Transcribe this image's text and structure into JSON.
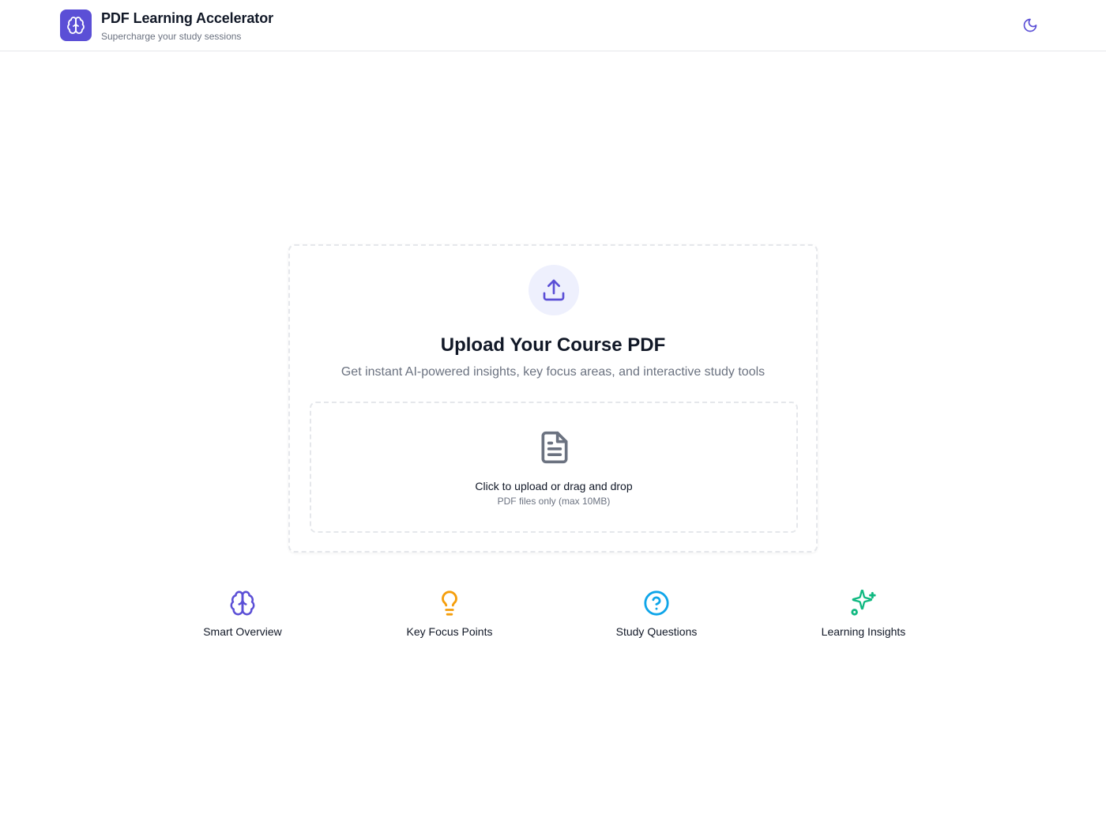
{
  "header": {
    "title": "PDF Learning Accelerator",
    "subtitle": "Supercharge your study sessions",
    "logo_icon": "brain-icon",
    "theme_toggle_icon": "moon-icon"
  },
  "upload": {
    "icon": "upload-icon",
    "title": "Upload Your Course PDF",
    "description": "Get instant AI-powered insights, key focus areas, and interactive study tools",
    "dropzone": {
      "icon": "file-text-icon",
      "primary": "Click to upload or drag and drop",
      "secondary": "PDF files only (max 10MB)"
    }
  },
  "features": [
    {
      "label": "Smart Overview",
      "icon": "brain-icon",
      "color": "#5b4fd6"
    },
    {
      "label": "Key Focus Points",
      "icon": "lightbulb-icon",
      "color": "#f59e0b"
    },
    {
      "label": "Study Questions",
      "icon": "help-circle-icon",
      "color": "#0ea5e9"
    },
    {
      "label": "Learning Insights",
      "icon": "sparkles-icon",
      "color": "#10b981"
    }
  ],
  "colors": {
    "accent": "#5b4fd6",
    "accent_soft": "#eef0fd",
    "text_primary": "#111827",
    "text_muted": "#6b7280",
    "border": "#e5e7eb"
  }
}
